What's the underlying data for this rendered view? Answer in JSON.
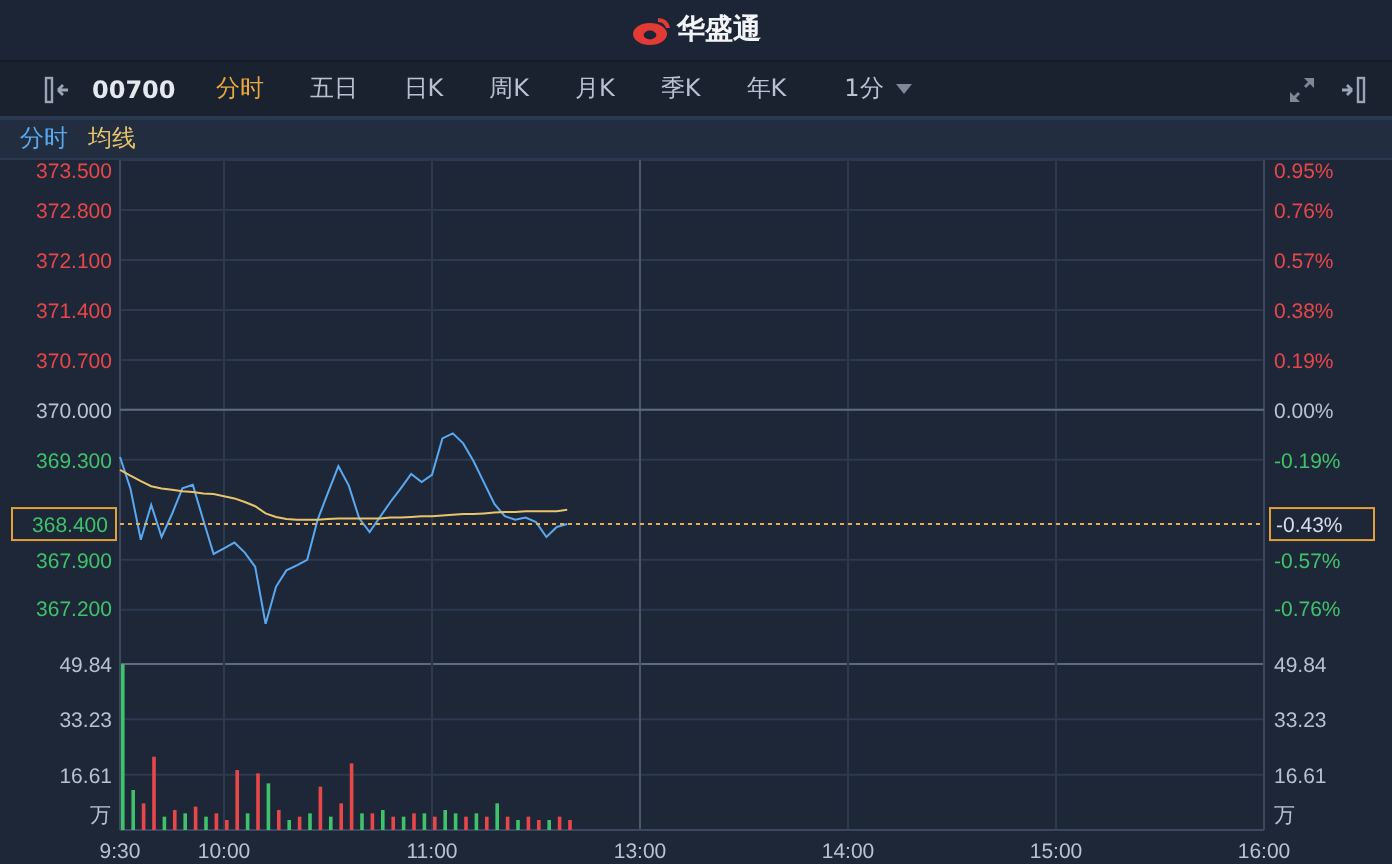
{
  "header": {
    "brand": "华盛通"
  },
  "toolbar": {
    "symbol": "00700",
    "tabs": [
      {
        "label": "分时",
        "selected": true
      },
      {
        "label": "五日",
        "selected": false
      },
      {
        "label": "日K",
        "selected": false
      },
      {
        "label": "周K",
        "selected": false
      },
      {
        "label": "月K",
        "selected": false
      },
      {
        "label": "季K",
        "selected": false
      },
      {
        "label": "年K",
        "selected": false
      }
    ],
    "interval": "1分"
  },
  "price_chart": {
    "percent_ticks": [
      {
        "label": "0.95%",
        "color": "#e8474a"
      },
      {
        "label": "0.76%",
        "color": "#e8474a"
      },
      {
        "label": "0.57%",
        "color": "#e8474a"
      },
      {
        "label": "0.38%",
        "color": "#e8474a"
      },
      {
        "label": "0.19%",
        "color": "#e8474a"
      },
      {
        "label": "0.00%",
        "color": "#b8c2d0"
      },
      {
        "label": "-0.19%",
        "color": "#3fc36a"
      },
      {
        "label": "-0.57%",
        "color": "#3fc36a"
      },
      {
        "label": "-0.76%",
        "color": "#3fc36a"
      }
    ],
    "marker": {
      "price_label": "368.400",
      "percent_label": "-0.43%"
    },
    "chart_data": {
      "type": "line",
      "grid": true,
      "categories": [
        null,
        null,
        null,
        null,
        null,
        null,
        null,
        null,
        null,
        null,
        null,
        null,
        null,
        null,
        null,
        null,
        null,
        null,
        null,
        null,
        null,
        null,
        null,
        null,
        null,
        null,
        null,
        null,
        null,
        null,
        null,
        null,
        null,
        null,
        null,
        null,
        null,
        null,
        null,
        null,
        null,
        null,
        null,
        null,
        null,
        null,
        null,
        null,
        null,
        null,
        null,
        null,
        null,
        null,
        null,
        null,
        null,
        null,
        null,
        null,
        null,
        null,
        null,
        null,
        null,
        null,
        null,
        null,
        null,
        null,
        null,
        null,
        null,
        null,
        null,
        null,
        null,
        null,
        null,
        null,
        null,
        null,
        null,
        null,
        null,
        null,
        null,
        null,
        null,
        null,
        null,
        null,
        null,
        null,
        null,
        null,
        null,
        null,
        null,
        null,
        null,
        null,
        null,
        null,
        null,
        null,
        null,
        null,
        null,
        null,
        null
      ],
      "series": [
        {
          "name": "分时",
          "color": "#5aa9f0",
          "values": [
            369.34,
            368.9,
            368.18,
            368.67,
            368.22,
            368.54,
            368.9,
            368.95,
            368.46,
            367.98,
            368.06,
            368.14,
            368.0,
            367.8,
            367.0,
            367.52,
            367.75,
            367.82,
            367.9,
            368.46,
            368.84,
            369.21,
            368.94,
            368.48,
            368.29,
            368.5,
            368.71,
            368.9,
            369.1,
            368.99,
            369.09,
            369.6,
            369.67,
            369.53,
            369.28,
            368.98,
            368.68,
            368.51,
            368.46,
            368.49,
            368.43,
            368.22,
            368.36,
            368.4,
            null,
            null,
            null,
            null,
            null,
            null,
            null,
            null,
            null,
            null,
            null,
            null,
            null,
            null,
            null,
            null,
            null,
            null,
            null,
            null,
            null,
            null,
            null,
            null,
            null,
            null,
            null,
            null,
            null,
            null,
            null,
            null,
            null,
            null,
            null,
            null,
            null,
            null,
            null,
            null,
            null,
            null,
            null,
            null,
            null,
            null,
            null,
            null,
            null,
            null,
            null,
            null,
            null,
            null,
            null,
            null,
            null,
            null,
            null,
            null,
            null,
            null,
            null,
            null,
            null,
            null,
            null
          ]
        },
        {
          "name": "均线",
          "color": "#e8c46a",
          "values": [
            369.16,
            369.08,
            369.0,
            368.93,
            368.9,
            368.88,
            368.86,
            368.85,
            368.83,
            368.82,
            368.79,
            368.76,
            368.71,
            368.65,
            368.55,
            368.5,
            368.47,
            368.46,
            368.46,
            368.46,
            368.47,
            368.48,
            368.48,
            368.48,
            368.48,
            368.48,
            368.49,
            368.49,
            368.5,
            368.51,
            368.51,
            368.52,
            368.53,
            368.54,
            368.54,
            368.55,
            368.56,
            368.57,
            368.57,
            368.58,
            368.58,
            368.58,
            368.58,
            368.6,
            null,
            null,
            null,
            null,
            null,
            null,
            null,
            null,
            null,
            null,
            null,
            null,
            null,
            null,
            null,
            null,
            null,
            null,
            null,
            null,
            null,
            null,
            null,
            null,
            null,
            null,
            null,
            null,
            null,
            null,
            null,
            null,
            null,
            null,
            null,
            null,
            null,
            null,
            null,
            null,
            null,
            null,
            null,
            null,
            null,
            null,
            null,
            null,
            null,
            null,
            null,
            null,
            null,
            null,
            null,
            null,
            null,
            null,
            null,
            null,
            null,
            null,
            null,
            null,
            null,
            null,
            null
          ]
        }
      ],
      "ylim": [
        367.0,
        373.5
      ],
      "yticks": [
        {
          "value": 373.5,
          "label": "373.500"
        },
        {
          "value": 372.8,
          "label": "372.800"
        },
        {
          "value": 372.1,
          "label": "372.100"
        },
        {
          "value": 371.4,
          "label": "371.400"
        },
        {
          "value": 370.7,
          "label": "370.700"
        },
        {
          "value": 370.0,
          "label": "370.000"
        },
        {
          "value": 369.3,
          "label": "369.300"
        },
        {
          "value": 367.9,
          "label": "367.900"
        },
        {
          "value": 367.2,
          "label": "367.200"
        }
      ]
    }
  },
  "volume_chart": {
    "unit_labels": [
      "万",
      "万"
    ],
    "right_yticks": [
      "49.84",
      "33.23",
      "16.61"
    ],
    "chart_data": {
      "type": "bar",
      "grid": true,
      "categories": [
        "9:30",
        null,
        null,
        null,
        null,
        null,
        null,
        null,
        null,
        null,
        "10:00",
        null,
        null,
        null,
        null,
        null,
        null,
        null,
        null,
        null,
        null,
        null,
        null,
        null,
        null,
        null,
        null,
        null,
        null,
        null,
        "11:00",
        null,
        null,
        null,
        null,
        null,
        null,
        null,
        null,
        null,
        null,
        null,
        null,
        null,
        null,
        null,
        null,
        null,
        null,
        null,
        "13:00",
        null,
        null,
        null,
        null,
        null,
        null,
        null,
        null,
        null,
        null,
        null,
        null,
        null,
        null,
        null,
        null,
        null,
        null,
        null,
        "14:00",
        null,
        null,
        null,
        null,
        null,
        null,
        null,
        null,
        null,
        null,
        null,
        null,
        null,
        null,
        null,
        null,
        null,
        null,
        null,
        "15:00",
        null,
        null,
        null,
        null,
        null,
        null,
        null,
        null,
        null,
        null,
        null,
        null,
        null,
        null,
        null,
        null,
        null,
        null,
        null,
        "16:00"
      ],
      "series": [
        {
          "color": "#e8474a",
          "values": [
            null,
            null,
            8,
            22,
            null,
            6,
            null,
            7,
            null,
            5,
            3,
            18,
            null,
            17,
            null,
            6,
            null,
            4,
            null,
            13,
            null,
            8,
            20,
            null,
            5,
            null,
            4,
            null,
            5,
            null,
            4,
            null,
            null,
            4,
            null,
            4,
            null,
            4,
            null,
            4,
            3,
            null,
            4,
            3,
            null,
            null,
            null,
            null,
            null,
            null,
            null,
            null,
            null,
            null,
            null,
            null,
            null,
            null,
            null,
            null,
            null,
            null,
            null,
            null,
            null,
            null,
            null,
            null,
            null,
            null,
            null,
            null,
            null,
            null,
            null,
            null,
            null,
            null,
            null,
            null,
            null,
            null,
            null,
            null,
            null,
            null,
            null,
            null,
            null,
            null,
            null,
            null,
            null,
            null,
            null,
            null,
            null,
            null,
            null,
            null,
            null,
            null,
            null,
            null,
            null,
            null,
            null,
            null,
            null,
            null,
            null
          ]
        },
        {
          "color": "#3fc36a",
          "values": [
            49.8,
            12,
            null,
            null,
            4,
            null,
            5,
            null,
            4,
            null,
            null,
            null,
            5,
            null,
            14,
            null,
            3,
            null,
            5,
            null,
            4,
            null,
            null,
            5,
            null,
            6,
            null,
            4,
            null,
            5,
            null,
            6,
            5,
            null,
            5,
            null,
            8,
            null,
            3,
            null,
            null,
            3,
            null,
            null,
            null,
            null,
            null,
            null,
            null,
            null,
            null,
            null,
            null,
            null,
            null,
            null,
            null,
            null,
            null,
            null,
            null,
            null,
            null,
            null,
            null,
            null,
            null,
            null,
            null,
            null,
            null,
            null,
            null,
            null,
            null,
            null,
            null,
            null,
            null,
            null,
            null,
            null,
            null,
            null,
            null,
            null,
            null,
            null,
            null,
            null,
            null,
            null,
            null,
            null,
            null,
            null,
            null,
            null,
            null,
            null,
            null,
            null,
            null,
            null,
            null,
            null,
            null,
            null,
            null,
            null,
            null
          ]
        }
      ],
      "ylim": [
        0,
        49.84
      ],
      "yticks": [
        {
          "value": 49.84,
          "label": "49.84"
        },
        {
          "value": 33.23,
          "label": "33.23"
        },
        {
          "value": 16.61,
          "label": "16.61"
        }
      ]
    }
  }
}
